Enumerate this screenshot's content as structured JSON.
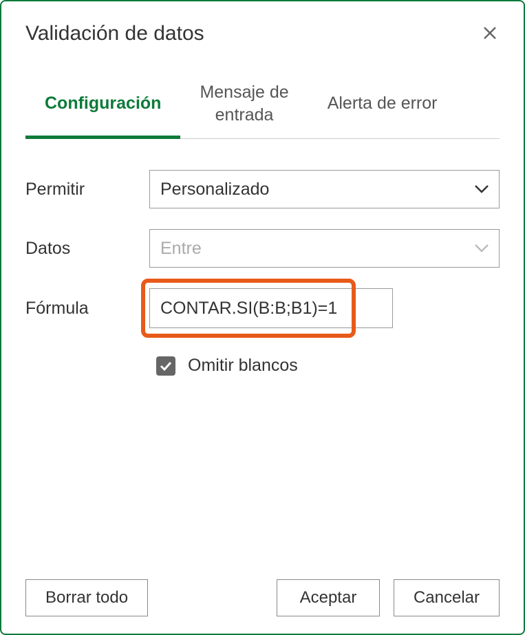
{
  "dialog": {
    "title": "Validación de datos"
  },
  "tabs": {
    "config": "Configuración",
    "input_msg_line1": "Mensaje de",
    "input_msg_line2": "entrada",
    "error_alert": "Alerta de error"
  },
  "form": {
    "allow_label": "Permitir",
    "allow_value": "Personalizado",
    "data_label": "Datos",
    "data_value": "Entre",
    "formula_label": "Fórmula",
    "formula_value": "CONTAR.SI(B:B;B1)=1",
    "ignore_blank_label": "Omitir blancos"
  },
  "buttons": {
    "clear_all": "Borrar todo",
    "ok": "Aceptar",
    "cancel": "Cancelar"
  }
}
